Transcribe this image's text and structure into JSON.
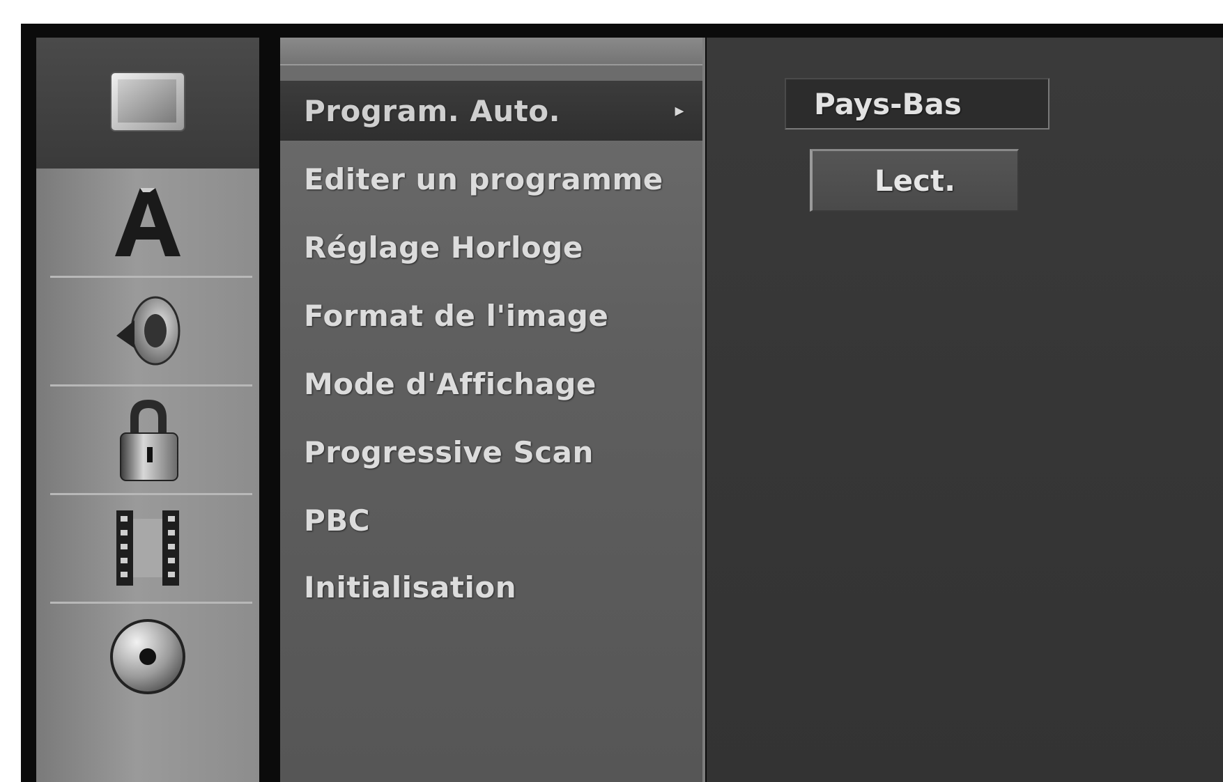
{
  "menu": {
    "items": [
      {
        "label": "Program. Auto.",
        "selected": true
      },
      {
        "label": "Editer un programme"
      },
      {
        "label": "Réglage Horloge"
      },
      {
        "label": "Format de l'image"
      },
      {
        "label": "Mode d'Affichage"
      },
      {
        "label": "Progressive Scan"
      },
      {
        "label": "PBC"
      },
      {
        "label": "Initialisation"
      }
    ],
    "submenu_arrow": "▸"
  },
  "options": {
    "country_value": "Pays-Bas",
    "play_button_label": "Lect."
  },
  "icons": [
    "tv-icon",
    "language-icon",
    "audio-icon",
    "lock-icon",
    "film-icon",
    "disc-icon"
  ],
  "colors": {
    "background": "#0b0b0b",
    "selected": "#333333",
    "menu": "#606060",
    "icon_column": "#8e8e8e",
    "text": "#dcdcdc"
  }
}
